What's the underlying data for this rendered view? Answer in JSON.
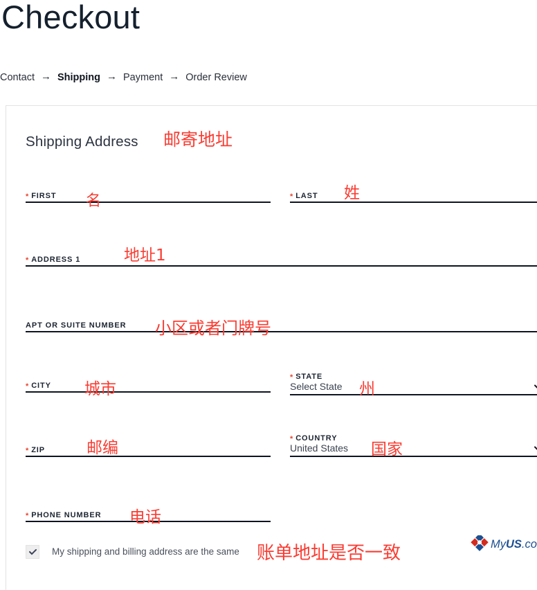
{
  "page": {
    "title": "Checkout"
  },
  "breadcrumb": {
    "arrow": "→",
    "steps": [
      {
        "label": "Contact",
        "active": false
      },
      {
        "label": "Shipping",
        "active": true
      },
      {
        "label": "Payment",
        "active": false
      },
      {
        "label": "Order Review",
        "active": false
      }
    ]
  },
  "form": {
    "section_title": "Shipping Address",
    "section_title_annotation": "邮寄地址",
    "required_marker": "*",
    "fields": {
      "first": {
        "label": "FIRST",
        "required": true,
        "annotation": "名",
        "value": ""
      },
      "last": {
        "label": "LAST",
        "required": true,
        "annotation": "姓",
        "value": ""
      },
      "address1": {
        "label": "ADDRESS 1",
        "required": true,
        "annotation": "地址1",
        "value": ""
      },
      "apt": {
        "label": "APT OR SUITE NUMBER",
        "required": false,
        "annotation": "小区或者门牌号",
        "value": ""
      },
      "city": {
        "label": "CITY",
        "required": true,
        "annotation": "城市",
        "value": ""
      },
      "state": {
        "label": "STATE",
        "required": true,
        "annotation": "州",
        "value": "Select State"
      },
      "zip": {
        "label": "ZIP",
        "required": true,
        "annotation": "邮编",
        "value": ""
      },
      "country": {
        "label": "COUNTRY",
        "required": true,
        "annotation": "国家",
        "value": "United States"
      },
      "phone": {
        "label": "PHONE NUMBER",
        "required": true,
        "annotation": "电话",
        "value": ""
      }
    },
    "billing_same": {
      "label": "My shipping and billing address are the same",
      "annotation": "账单地址是否一致",
      "checked": true
    }
  },
  "logo": {
    "my": "My",
    "us": "US",
    "com": ".com"
  },
  "colors": {
    "annotation_red": "#fa3c32",
    "required_red": "#e8442e",
    "text_dark": "#1b2330",
    "underline": "#0d1420",
    "logo_blue": "#1d4f91",
    "logo_red": "#d42b1f"
  }
}
